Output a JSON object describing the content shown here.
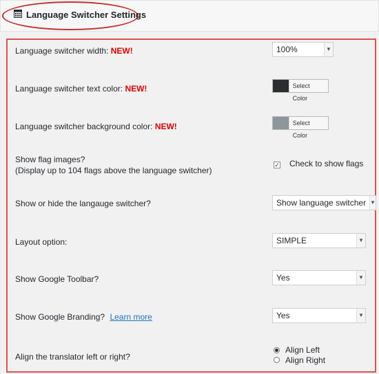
{
  "header": {
    "title": "Language Switcher Settings",
    "icon": "settings-panel-icon"
  },
  "badge_new": "NEW!",
  "rows": {
    "width": {
      "label": "Language switcher width:",
      "value": "100%"
    },
    "text_color": {
      "label": "Language switcher text color:",
      "button": "Select Color",
      "color": "#2b2d30"
    },
    "bg_color": {
      "label": "Language switcher background color:",
      "button": "Select Color",
      "color": "#8d979b"
    },
    "flags": {
      "label": "Show flag images?",
      "sublabel": "(Display up to 104 flags above the language switcher)",
      "checkbox_label": "Check to show flags",
      "checked": true,
      "check_glyph": "✓"
    },
    "show_hide": {
      "label": "Show or hide the langauge switcher?",
      "value": "Show language switcher"
    },
    "layout": {
      "label": "Layout option:",
      "value": "SIMPLE"
    },
    "toolbar": {
      "label": "Show Google Toolbar?",
      "value": "Yes"
    },
    "branding": {
      "label": "Show Google Branding?",
      "link": "Learn more",
      "value": "Yes"
    },
    "align": {
      "label": "Align the translator left or right?",
      "options": [
        "Align Left",
        "Align Right"
      ],
      "selected": "Align Left"
    }
  },
  "colors": {
    "accent_red": "#d9534f",
    "new_red": "#dd0000",
    "link": "#1e73be"
  }
}
